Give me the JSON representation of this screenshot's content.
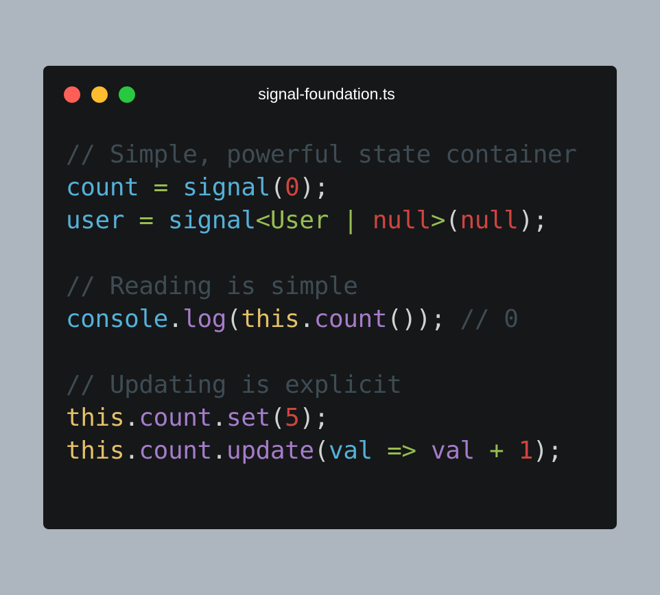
{
  "window": {
    "title": "signal-foundation.ts",
    "traffic_lights": {
      "close_color": "#fe5f57",
      "minimize_color": "#febc2e",
      "maximize_color": "#28c840"
    },
    "background_color": "#161719"
  },
  "theme": {
    "comment": "#3e4c53",
    "identifier": "#54b1d8",
    "call": "#54b1d8",
    "keyword_this": "#e2c16a",
    "member": "#a57cc9",
    "type": "#97bd52",
    "number_null": "#d0453f",
    "punctuation": "#d1d2d2",
    "operator": "#97bd52"
  },
  "code": {
    "lines": [
      [
        {
          "text": "// Simple, powerful state container",
          "color": "#3e4c53"
        }
      ],
      [
        {
          "text": "count",
          "color": "#54b1d8"
        },
        {
          "text": " ",
          "color": "#d1d2d2"
        },
        {
          "text": "=",
          "color": "#97bd52"
        },
        {
          "text": " ",
          "color": "#d1d2d2"
        },
        {
          "text": "signal",
          "color": "#54b1d8"
        },
        {
          "text": "(",
          "color": "#d1d2d2"
        },
        {
          "text": "0",
          "color": "#d0453f"
        },
        {
          "text": ");",
          "color": "#d1d2d2"
        }
      ],
      [
        {
          "text": "user",
          "color": "#54b1d8"
        },
        {
          "text": " ",
          "color": "#d1d2d2"
        },
        {
          "text": "=",
          "color": "#97bd52"
        },
        {
          "text": " ",
          "color": "#d1d2d2"
        },
        {
          "text": "signal",
          "color": "#54b1d8"
        },
        {
          "text": "<User | ",
          "color": "#97bd52"
        },
        {
          "text": "null",
          "color": "#d0453f"
        },
        {
          "text": ">",
          "color": "#97bd52"
        },
        {
          "text": "(",
          "color": "#d1d2d2"
        },
        {
          "text": "null",
          "color": "#d0453f"
        },
        {
          "text": ");",
          "color": "#d1d2d2"
        }
      ],
      [],
      [
        {
          "text": "// Reading is simple",
          "color": "#3e4c53"
        }
      ],
      [
        {
          "text": "console",
          "color": "#54b1d8"
        },
        {
          "text": ".",
          "color": "#d1d2d2"
        },
        {
          "text": "log",
          "color": "#a57cc9"
        },
        {
          "text": "(",
          "color": "#d1d2d2"
        },
        {
          "text": "this",
          "color": "#e2c16a"
        },
        {
          "text": ".",
          "color": "#d1d2d2"
        },
        {
          "text": "count",
          "color": "#a57cc9"
        },
        {
          "text": "()); ",
          "color": "#d1d2d2"
        },
        {
          "text": "// 0",
          "color": "#3e4c53"
        }
      ],
      [],
      [
        {
          "text": "// Updating is explicit",
          "color": "#3e4c53"
        }
      ],
      [
        {
          "text": "this",
          "color": "#e2c16a"
        },
        {
          "text": ".",
          "color": "#d1d2d2"
        },
        {
          "text": "count",
          "color": "#a57cc9"
        },
        {
          "text": ".",
          "color": "#d1d2d2"
        },
        {
          "text": "set",
          "color": "#a57cc9"
        },
        {
          "text": "(",
          "color": "#d1d2d2"
        },
        {
          "text": "5",
          "color": "#d0453f"
        },
        {
          "text": ");",
          "color": "#d1d2d2"
        }
      ],
      [
        {
          "text": "this",
          "color": "#e2c16a"
        },
        {
          "text": ".",
          "color": "#d1d2d2"
        },
        {
          "text": "count",
          "color": "#a57cc9"
        },
        {
          "text": ".",
          "color": "#d1d2d2"
        },
        {
          "text": "update",
          "color": "#a57cc9"
        },
        {
          "text": "(",
          "color": "#d1d2d2"
        },
        {
          "text": "val",
          "color": "#54b1d8"
        },
        {
          "text": " ",
          "color": "#d1d2d2"
        },
        {
          "text": "=>",
          "color": "#97bd52"
        },
        {
          "text": " ",
          "color": "#d1d2d2"
        },
        {
          "text": "val",
          "color": "#a57cc9"
        },
        {
          "text": " ",
          "color": "#d1d2d2"
        },
        {
          "text": "+",
          "color": "#97bd52"
        },
        {
          "text": " ",
          "color": "#d1d2d2"
        },
        {
          "text": "1",
          "color": "#d0453f"
        },
        {
          "text": ");",
          "color": "#d1d2d2"
        }
      ]
    ]
  }
}
